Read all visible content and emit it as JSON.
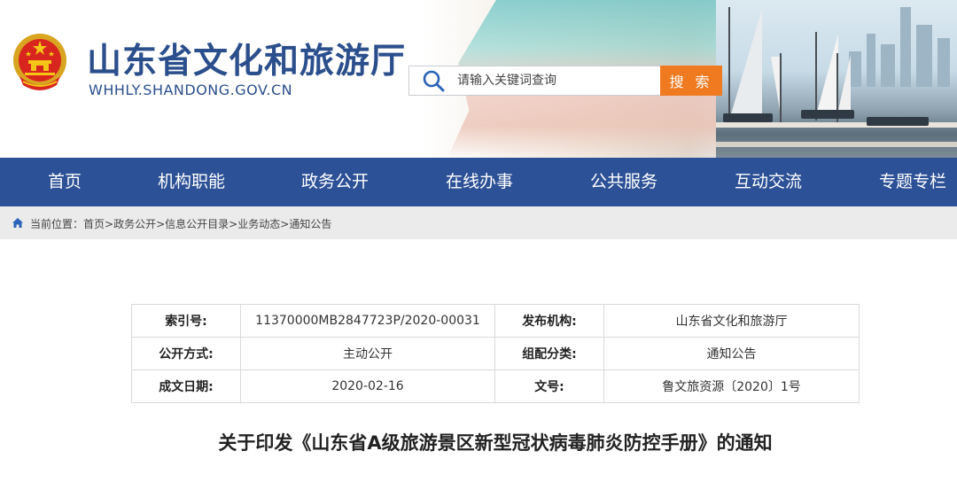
{
  "header": {
    "site_title": "山东省文化和旅游厅",
    "site_domain": "WHHLY.SHANDONG.GOV.CN",
    "emblem_icon": "national-emblem-icon",
    "brand_color": "#2b4f8c"
  },
  "search": {
    "placeholder": "请输入关键词查询",
    "button_label": "搜 索",
    "button_color": "#f07a20"
  },
  "nav": {
    "color": "#2d5196",
    "items": [
      "首页",
      "机构职能",
      "政务公开",
      "在线办事",
      "公共服务",
      "互动交流",
      "专题专栏"
    ]
  },
  "breadcrumb": {
    "prefix": "当前位置：",
    "items": [
      "首页",
      "政务公开",
      "信息公开目录",
      "业务动态",
      "通知公告"
    ],
    "separator": ">"
  },
  "meta": {
    "rows": [
      [
        {
          "k": "索引号:",
          "v": "11370000MB2847723P/2020-00031"
        },
        {
          "k": "发布机构:",
          "v": "山东省文化和旅游厅"
        }
      ],
      [
        {
          "k": "公开方式:",
          "v": "主动公开"
        },
        {
          "k": "组配分类:",
          "v": "通知公告"
        }
      ],
      [
        {
          "k": "成文日期:",
          "v": "2020-02-16"
        },
        {
          "k": "文号:",
          "v": "鲁文旅资源〔2020〕1号"
        }
      ]
    ]
  },
  "document": {
    "title": "关于印发《山东省A级旅游景区新型冠状病毒肺炎防控手册》的通知"
  }
}
